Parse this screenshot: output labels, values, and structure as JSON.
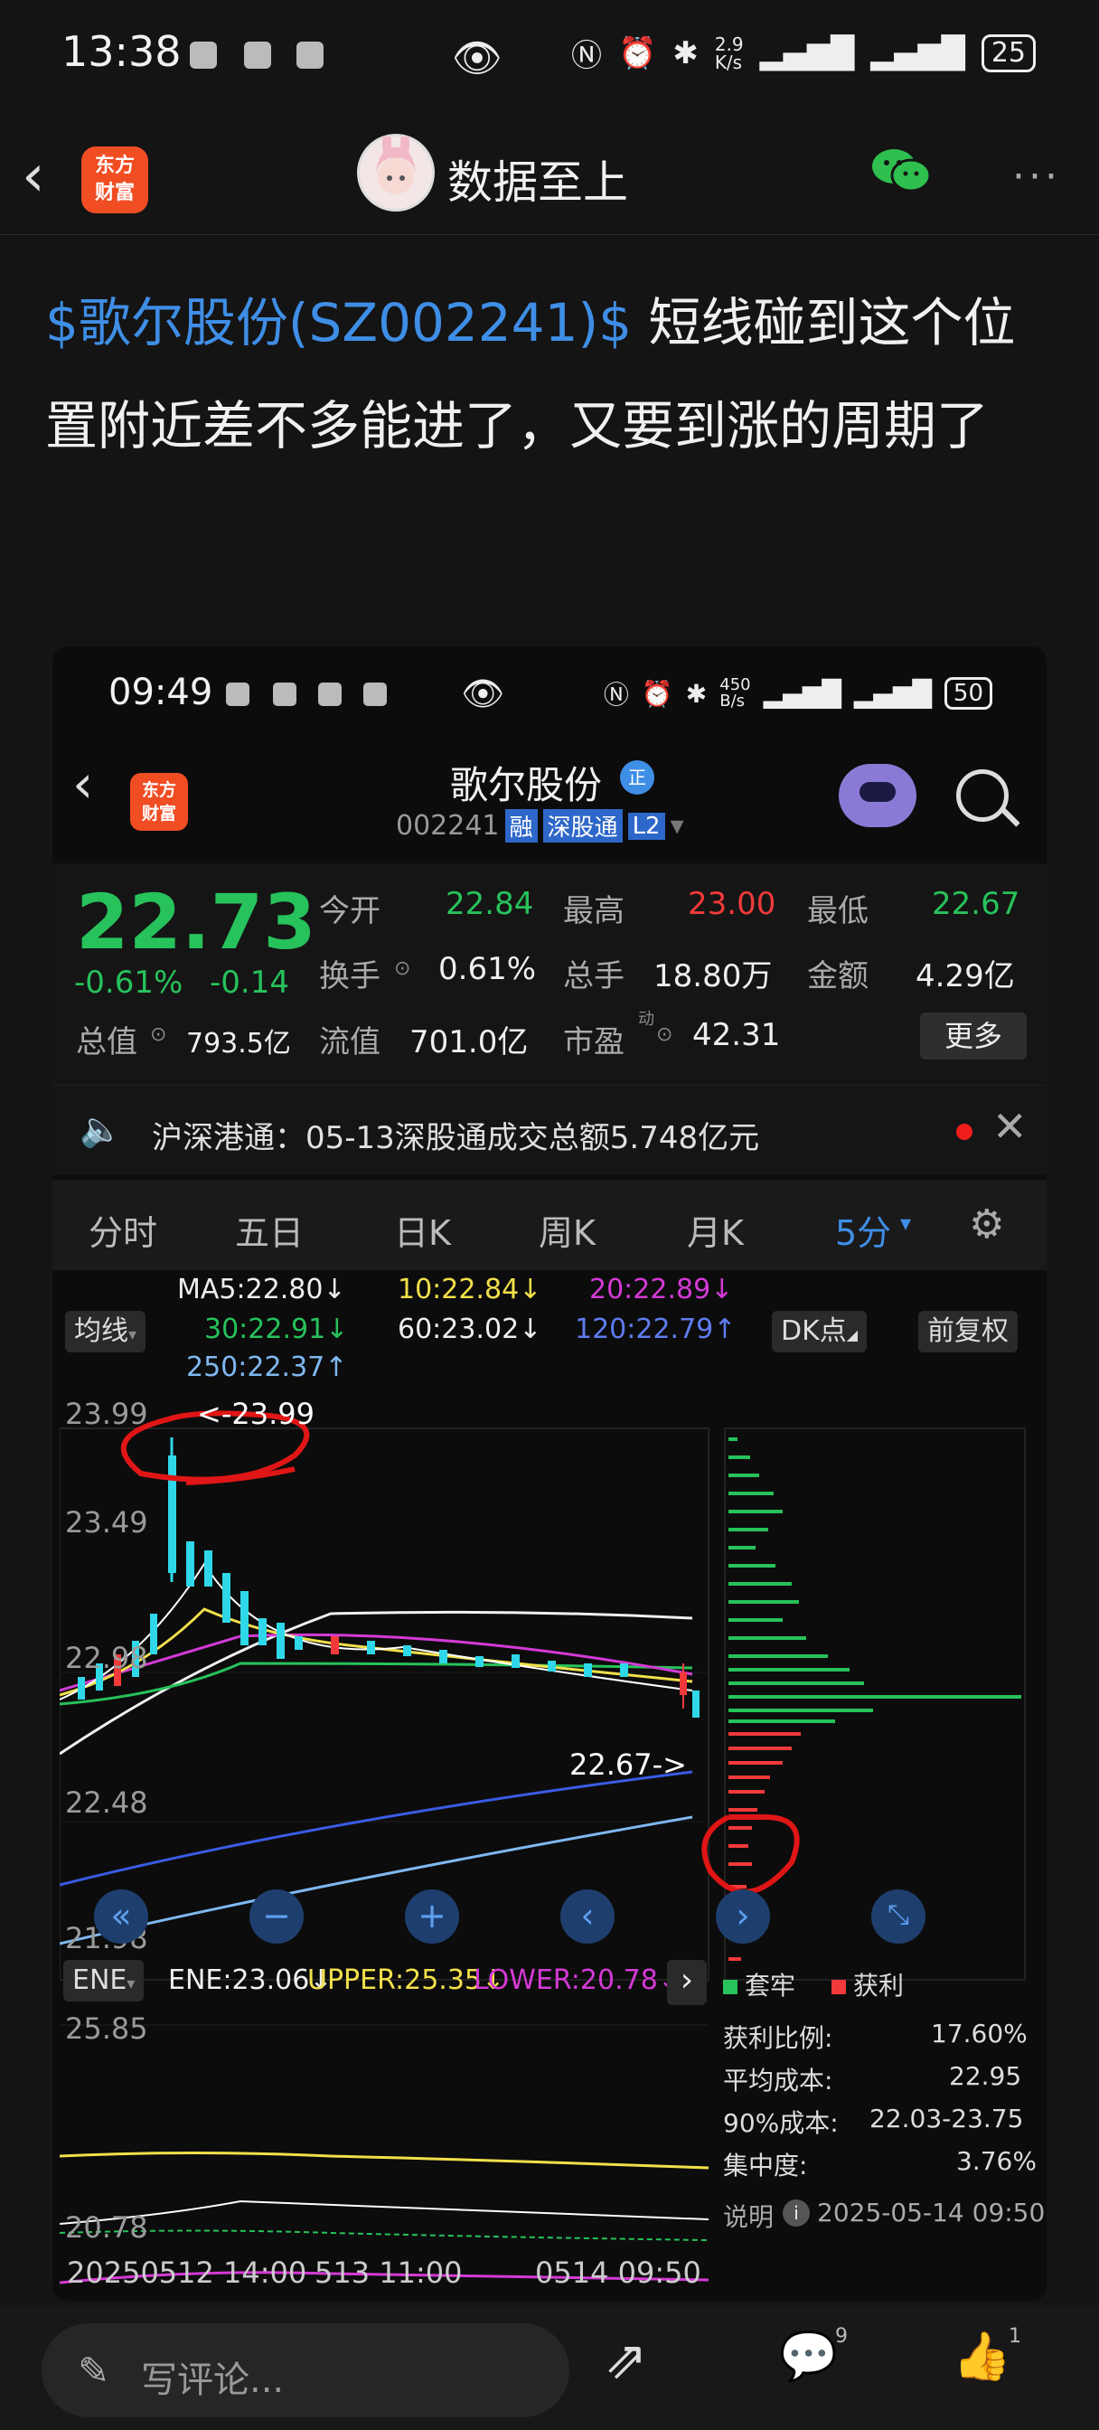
{
  "status_bar": {
    "time": "13:38",
    "net_speed": "2.9\nK/s",
    "battery": "25"
  },
  "app_bar": {
    "author": "数据至上",
    "logo_text": "东方\n财富",
    "more": "···"
  },
  "post": {
    "stock_tag": "$歌尔股份(SZ002241)$",
    "text": " 短线碰到这个位置附近差不多能进了，又要到涨的周期了"
  },
  "screenshot": {
    "status_bar": {
      "time": "09:49",
      "net_speed": "450\nB/s",
      "battery": "50"
    },
    "header": {
      "name": "歌尔股份",
      "badge": "正",
      "code": "002241",
      "tags": [
        "融",
        "深股通",
        "L2"
      ],
      "logo_text": "东方\n财富"
    },
    "quote": {
      "price": "22.73",
      "change_pct": "-0.61%",
      "change": "-0.14",
      "open_label": "今开",
      "open": "22.84",
      "high_label": "最高",
      "high": "23.00",
      "low_label": "最低",
      "low": "22.67",
      "turnover_label": "换手",
      "turnover": "0.61%",
      "volume_label": "总手",
      "volume": "18.80万",
      "amount_label": "金额",
      "amount": "4.29亿",
      "mcap_label": "总值",
      "mcap": "793.5亿",
      "float_label": "流值",
      "float": "701.0亿",
      "pe_label": "市盈",
      "pe_sup": "动",
      "pe": "42.31",
      "more_button": "更多"
    },
    "notice": {
      "text": "沪深港通：05-13深股通成交总额5.748亿元"
    },
    "tabs": [
      "分时",
      "五日",
      "日K",
      "周K",
      "月K",
      "5分"
    ],
    "ma": {
      "selector": "均线",
      "ma5": "MA5:22.80↓",
      "ma10": "10:22.84↓",
      "ma20": "20:22.89↓",
      "ma30": "30:22.91↓",
      "ma60": "60:23.02↓",
      "ma120": "120:22.79↑",
      "ma250": "250:22.37↑",
      "dk_button": "DK点",
      "adjust_button": "前复权"
    },
    "chart_axis": {
      "y1": "23.99",
      "y2": "23.49",
      "y3": "22.98",
      "y4": "22.48",
      "y5": "21.98"
    },
    "annotations": {
      "high_marker": "<-23.99",
      "low_marker": "22.67->"
    },
    "indicator": {
      "selector": "ENE",
      "ene": "ENE:23.06↓",
      "upper": "UPPER:25.35↓",
      "lower": "LOWER:20.78↓",
      "y_top": "25.85",
      "y_bottom": "20.78"
    },
    "x_axis": {
      "left": "20250512 14:00",
      "mid": "513 11:00",
      "right": "0514 09:50"
    },
    "chip": {
      "legend_trapped": "套牢",
      "legend_profit": "获利",
      "profit_ratio_label": "获利比例:",
      "profit_ratio": "17.60%",
      "avg_cost_label": "平均成本:",
      "avg_cost": "22.95",
      "cost90_label": "90%成本:",
      "cost90": "22.03-23.75",
      "concentration_label": "集中度:",
      "concentration": "3.76%",
      "note_label": "说明",
      "note_time": "2025-05-14 09:50"
    },
    "colors": {
      "up": "#f23a3a",
      "down": "#27c25b",
      "accent": "#3f8ee6",
      "ma5": "#ffffff",
      "ma10": "#f2e04a",
      "ma20": "#d43ad6",
      "ma30": "#27c25b",
      "ma60": "#ffffff",
      "ma120": "#3a5be6",
      "ma250": "#7fb8f0"
    }
  },
  "bottom_bar": {
    "placeholder": "写评论...",
    "comment_count": "9",
    "like_count": "1"
  }
}
